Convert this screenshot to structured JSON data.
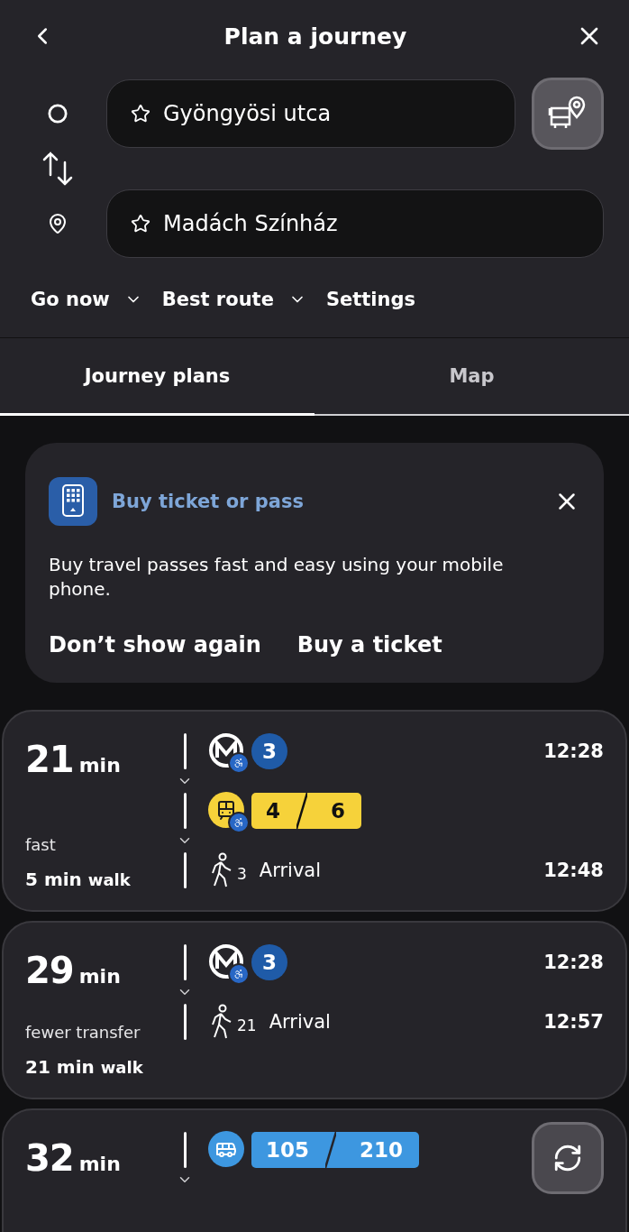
{
  "header": {
    "title": "Plan a journey"
  },
  "from": {
    "value": "Gyöngyösi utca"
  },
  "to": {
    "value": "Madách Színház"
  },
  "filters": [
    {
      "label": "Go now",
      "dropdown": true
    },
    {
      "label": "Best route",
      "dropdown": true
    },
    {
      "label": "Settings",
      "dropdown": false
    }
  ],
  "tabs": [
    {
      "label": "Journey plans",
      "selected": true
    },
    {
      "label": "Map",
      "selected": false
    }
  ],
  "promo": {
    "title": "Buy ticket or pass",
    "text": "Buy travel passes fast and easy using your mobile phone.",
    "actions": [
      "Don’t show again",
      "Buy a ticket"
    ]
  },
  "routes": [
    {
      "duration": "21",
      "unit": "min",
      "tag": "fast",
      "walk": "5 min",
      "walk_unit": "walk",
      "legs": [
        {
          "kind": "metro",
          "accessible": true,
          "lines": [
            "3"
          ],
          "time": "12:28"
        },
        {
          "kind": "tram",
          "accessible": true,
          "lines": [
            "4",
            "6"
          ]
        },
        {
          "kind": "walk",
          "minutes": "3",
          "label": "Arrival",
          "time": "12:48"
        }
      ]
    },
    {
      "duration": "29",
      "unit": "min",
      "tag": "fewer transfer",
      "walk": "21 min",
      "walk_unit": "walk",
      "legs": [
        {
          "kind": "metro",
          "accessible": true,
          "lines": [
            "3"
          ],
          "time": "12:28"
        },
        {
          "kind": "walk",
          "minutes": "21",
          "label": "Arrival",
          "time": "12:57"
        }
      ]
    },
    {
      "duration": "32",
      "unit": "min",
      "more": true,
      "legs": [
        {
          "kind": "bus",
          "accessible": false,
          "lines": [
            "105",
            "210"
          ]
        }
      ]
    }
  ]
}
